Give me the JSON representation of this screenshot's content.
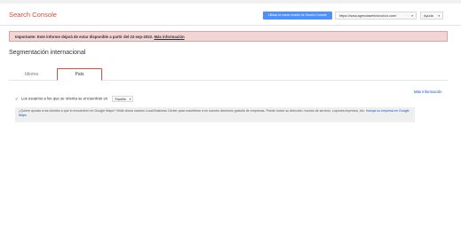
{
  "header": {
    "logo": "Search Console",
    "new_version_button": "Utilizar la nueva versión de Search Console",
    "site_selector": "https://www.agenciaweb/orvolc/o.com/",
    "help_button": "Ayuda"
  },
  "alert": {
    "label": "Importante:",
    "message": "Este informe dejará de estar disponible a partir del 22-sep-2022.",
    "link": "Más información"
  },
  "page_title": "Segmentación internacional",
  "tabs": [
    {
      "label": "Idioma"
    },
    {
      "label": "País"
    }
  ],
  "more_info_link": "Más información",
  "target_country": {
    "checkmark": "✓",
    "label": "Los usuarios a los que se orienta se encuentran en",
    "selected": "España"
  },
  "infobox": {
    "text": "¿Quiere ayudar a los clientes a que lo encuentren en Google Maps? Visite ahora nuestro Local Business Center para suscribirse a en nuestro directorio gratuito de empresas. Puede incluir su dirección, horario de servicio, cupones impresos, etc.",
    "link": "Incluya su empresa en Google Maps"
  }
}
